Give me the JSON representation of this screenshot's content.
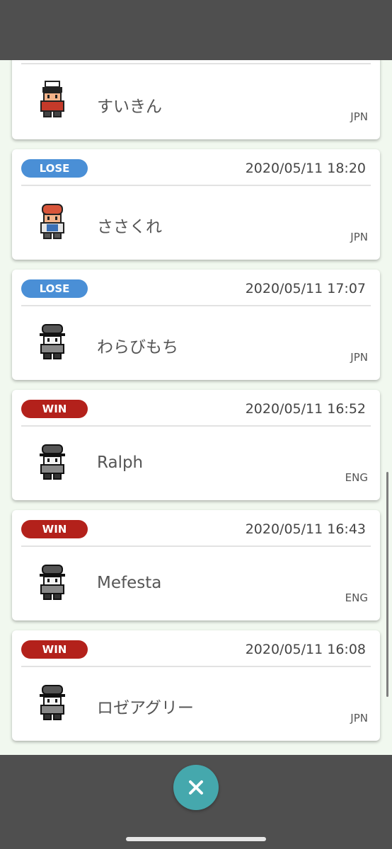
{
  "battles": [
    {
      "result": "",
      "date": "",
      "name": "すいきん",
      "lang": "JPN",
      "avatar": "red-trainer-icon"
    },
    {
      "result": "LOSE",
      "date": "2020/05/11 18:20",
      "name": "ささくれ",
      "lang": "JPN",
      "avatar": "orange-trainer-icon"
    },
    {
      "result": "LOSE",
      "date": "2020/05/11 17:07",
      "name": "わらびもち",
      "lang": "JPN",
      "avatar": "grey-trainer-icon"
    },
    {
      "result": "WIN",
      "date": "2020/05/11 16:52",
      "name": "Ralph",
      "lang": "ENG",
      "avatar": "grey-trainer-icon"
    },
    {
      "result": "WIN",
      "date": "2020/05/11 16:43",
      "name": "Mefesta",
      "lang": "ENG",
      "avatar": "grey-trainer-icon"
    },
    {
      "result": "WIN",
      "date": "2020/05/11 16:08",
      "name": "ロゼアグリー",
      "lang": "JPN",
      "avatar": "grey-trainer-icon"
    }
  ],
  "close_button": {
    "icon": "close-icon"
  },
  "colors": {
    "win": "#b3211b",
    "lose": "#4a8fd6",
    "bar": "#4f4f4f",
    "close": "#45a8ad"
  }
}
